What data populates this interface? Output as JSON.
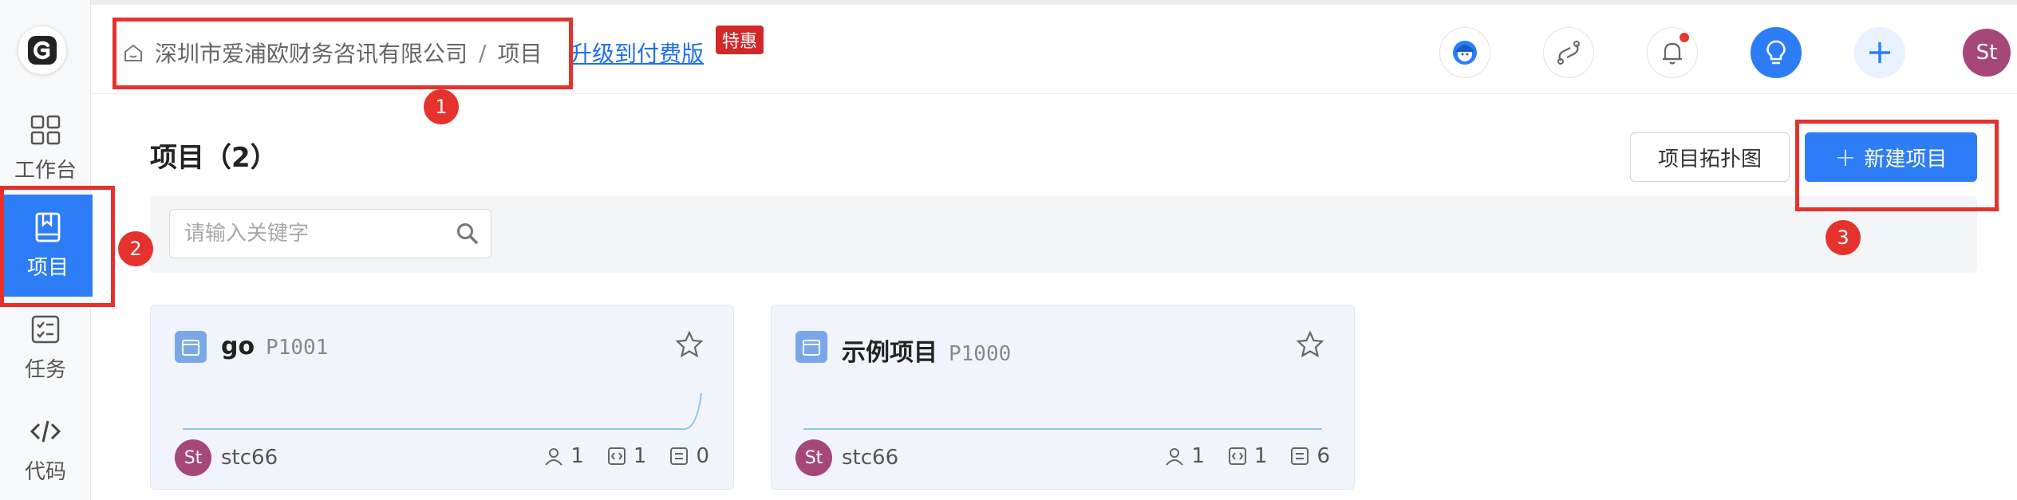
{
  "sidebar": {
    "logo": "G",
    "items": [
      {
        "label": "工作台",
        "icon": "grid-icon"
      },
      {
        "label": "项目",
        "icon": "book-icon"
      },
      {
        "label": "任务",
        "icon": "checklist-icon"
      },
      {
        "label": "代码",
        "icon": "code-icon"
      }
    ]
  },
  "header": {
    "breadcrumb": [
      "深圳市爱浦欧财务咨讯有限公司",
      "项目"
    ],
    "breadcrumb_sep": "/",
    "upgrade_link": "升级到付费版",
    "promo_badge": "特惠",
    "icons": [
      "support-icon",
      "link-icon",
      "bell-icon",
      "lightbulb-icon",
      "plus-icon"
    ],
    "user_initials": "St"
  },
  "main": {
    "title": "项目（2）",
    "topology_button": "项目拓扑图",
    "new_button": "新建项目",
    "new_button_icon": "+",
    "search_placeholder": "请输入关键字",
    "sort_icon": "⇅",
    "more_icon": "···"
  },
  "projects": [
    {
      "name": "go",
      "code": "P1001",
      "owner_initials": "St",
      "owner": "stc66",
      "members": "1",
      "repos": "1",
      "tasks": "0"
    },
    {
      "name": "示例项目",
      "code": "P1000",
      "owner_initials": "St",
      "owner": "stc66",
      "members": "1",
      "repos": "1",
      "tasks": "6"
    }
  ],
  "annotations": [
    "1",
    "2",
    "3"
  ],
  "colors": {
    "accent": "#2d7df6",
    "annotation": "#e5322d",
    "avatar": "#a64779",
    "promo": "#d32828"
  }
}
